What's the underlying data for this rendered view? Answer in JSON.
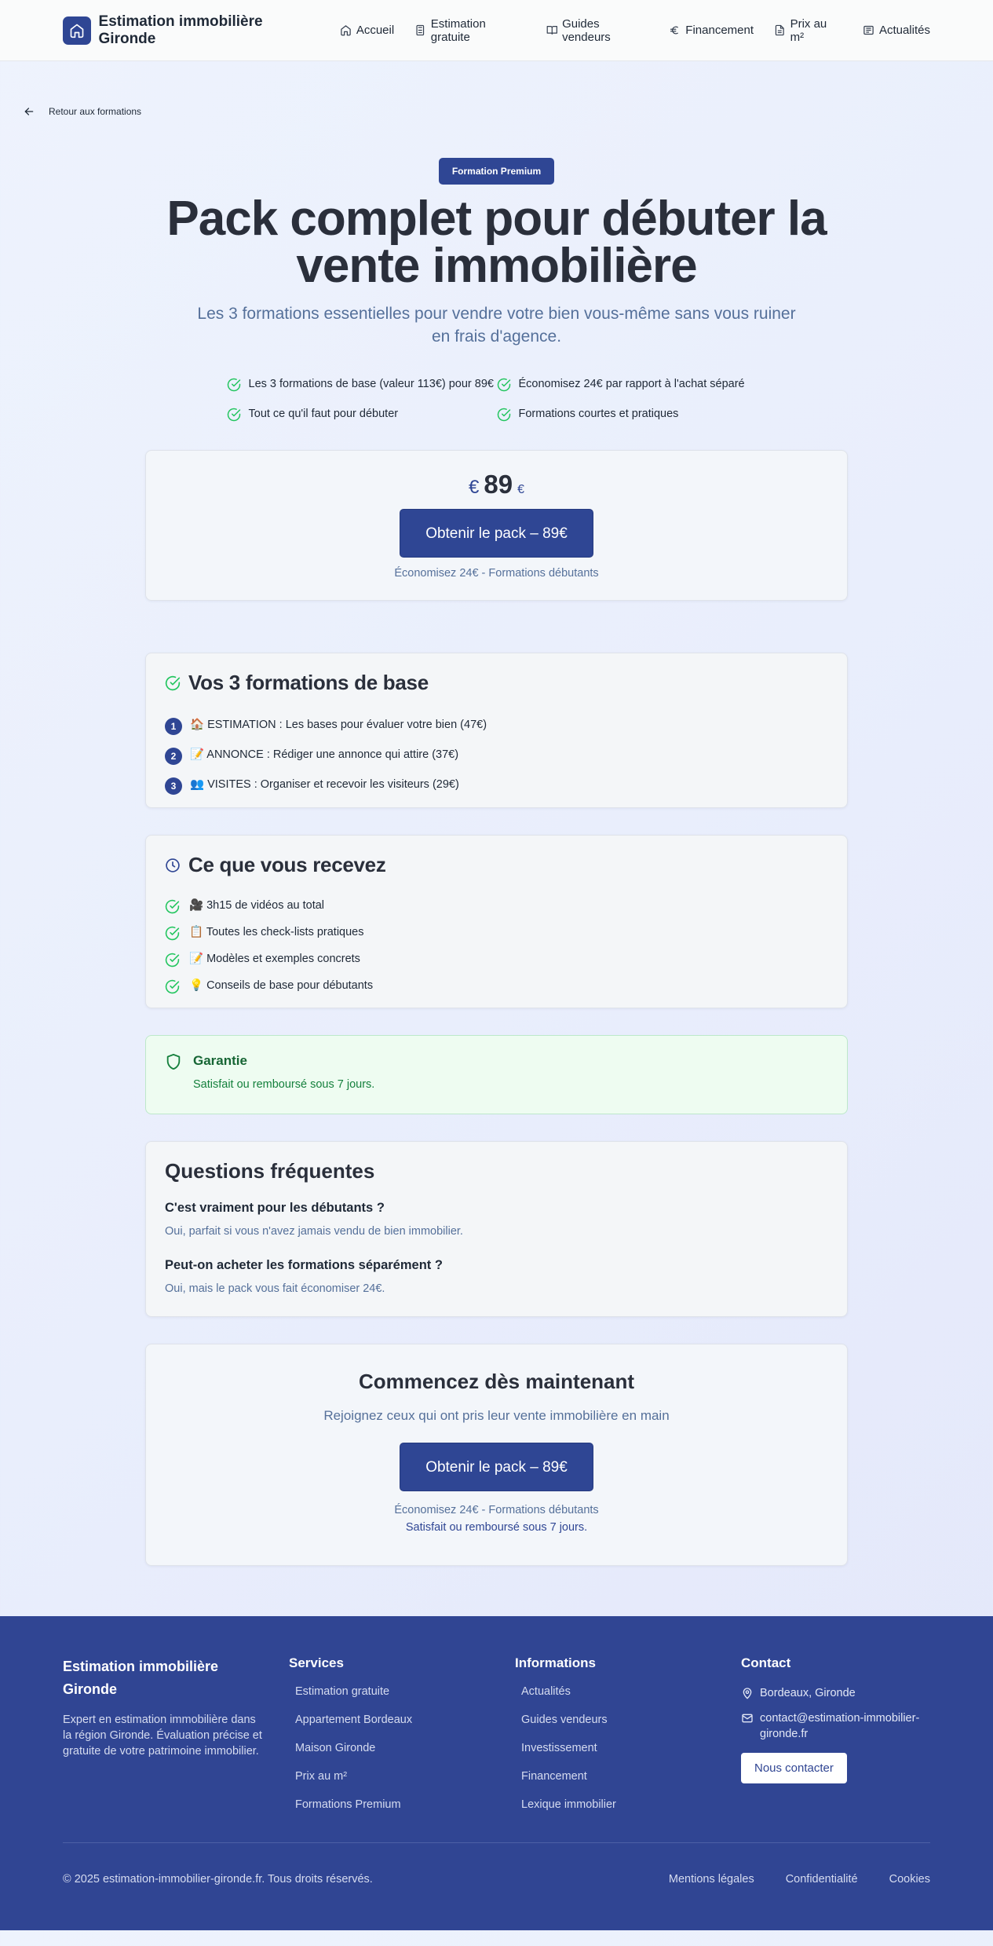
{
  "nav": {
    "brand": "Estimation immobilière Gironde",
    "links": [
      "Accueil",
      "Estimation gratuite",
      "Guides vendeurs",
      "Financement",
      "Prix au m²",
      "Actualités"
    ]
  },
  "back": {
    "label": "Retour aux formations"
  },
  "hero": {
    "badge": "Formation Premium",
    "title": "Pack complet pour débuter la vente immobilière",
    "subtitle": "Les 3 formations essentielles pour vendre votre bien vous-même sans vous ruiner en frais d'agence.",
    "features": [
      "Les 3 formations de base (valeur 113€) pour 89€",
      "Économisez 24€ par rapport à l'achat séparé",
      "Tout ce qu'il faut pour débuter",
      "Formations courtes et pratiques"
    ]
  },
  "price": {
    "currency_symbol": "€",
    "amount": "89",
    "currency_suffix": "€",
    "cta": "Obtenir le pack – 89€",
    "note": "Économisez 24€ - Formations débutants"
  },
  "formations": {
    "title": "Vos 3 formations de base",
    "items": [
      {
        "num": "1",
        "text": "🏠 ESTIMATION : Les bases pour évaluer votre bien (47€)"
      },
      {
        "num": "2",
        "text": "📝 ANNONCE : Rédiger une annonce qui attire (37€)"
      },
      {
        "num": "3",
        "text": "👥 VISITES : Organiser et recevoir les visiteurs (29€)"
      }
    ]
  },
  "receive": {
    "title": "Ce que vous recevez",
    "items": [
      "🎥 3h15 de vidéos au total",
      "📋 Toutes les check-lists pratiques",
      "📝 Modèles et exemples concrets",
      "💡 Conseils de base pour débutants"
    ]
  },
  "guarantee": {
    "title": "Garantie",
    "text": "Satisfait ou remboursé sous 7 jours."
  },
  "faq": {
    "title": "Questions fréquentes",
    "items": [
      {
        "q": "C'est vraiment pour les débutants ?",
        "a": "Oui, parfait si vous n'avez jamais vendu de bien immobilier."
      },
      {
        "q": "Peut-on acheter les formations séparément ?",
        "a": "Oui, mais le pack vous fait économiser 24€."
      }
    ]
  },
  "final": {
    "title": "Commencez dès maintenant",
    "subtitle": "Rejoignez ceux qui ont pris leur vente immobilière en main",
    "cta": "Obtenir le pack – 89€",
    "note": "Économisez 24€ - Formations débutants",
    "guarantee": "Satisfait ou remboursé sous 7 jours."
  },
  "footer": {
    "brand": "Estimation immobilière Gironde",
    "description": "Expert en estimation immobilière dans la région Gironde. Évaluation précise et gratuite de votre patrimoine immobilier.",
    "services_title": "Services",
    "services": [
      "Estimation gratuite",
      "Appartement Bordeaux",
      "Maison Gironde",
      "Prix au m²",
      "Formations Premium"
    ],
    "info_title": "Informations",
    "info": [
      "Actualités",
      "Guides vendeurs",
      "Investissement",
      "Financement",
      "Lexique immobilier"
    ],
    "contact_title": "Contact",
    "location": "Bordeaux, Gironde",
    "email": "contact@estimation-immobilier-gironde.fr",
    "contact_btn": "Nous contacter",
    "copyright": "© 2025 estimation-immobilier-gironde.fr. Tous droits réservés.",
    "legal": [
      "Mentions légales",
      "Confidentialité",
      "Cookies"
    ]
  },
  "colors": {
    "primary": "#2f4694",
    "success": "#22c55e",
    "muted": "#55709a"
  }
}
